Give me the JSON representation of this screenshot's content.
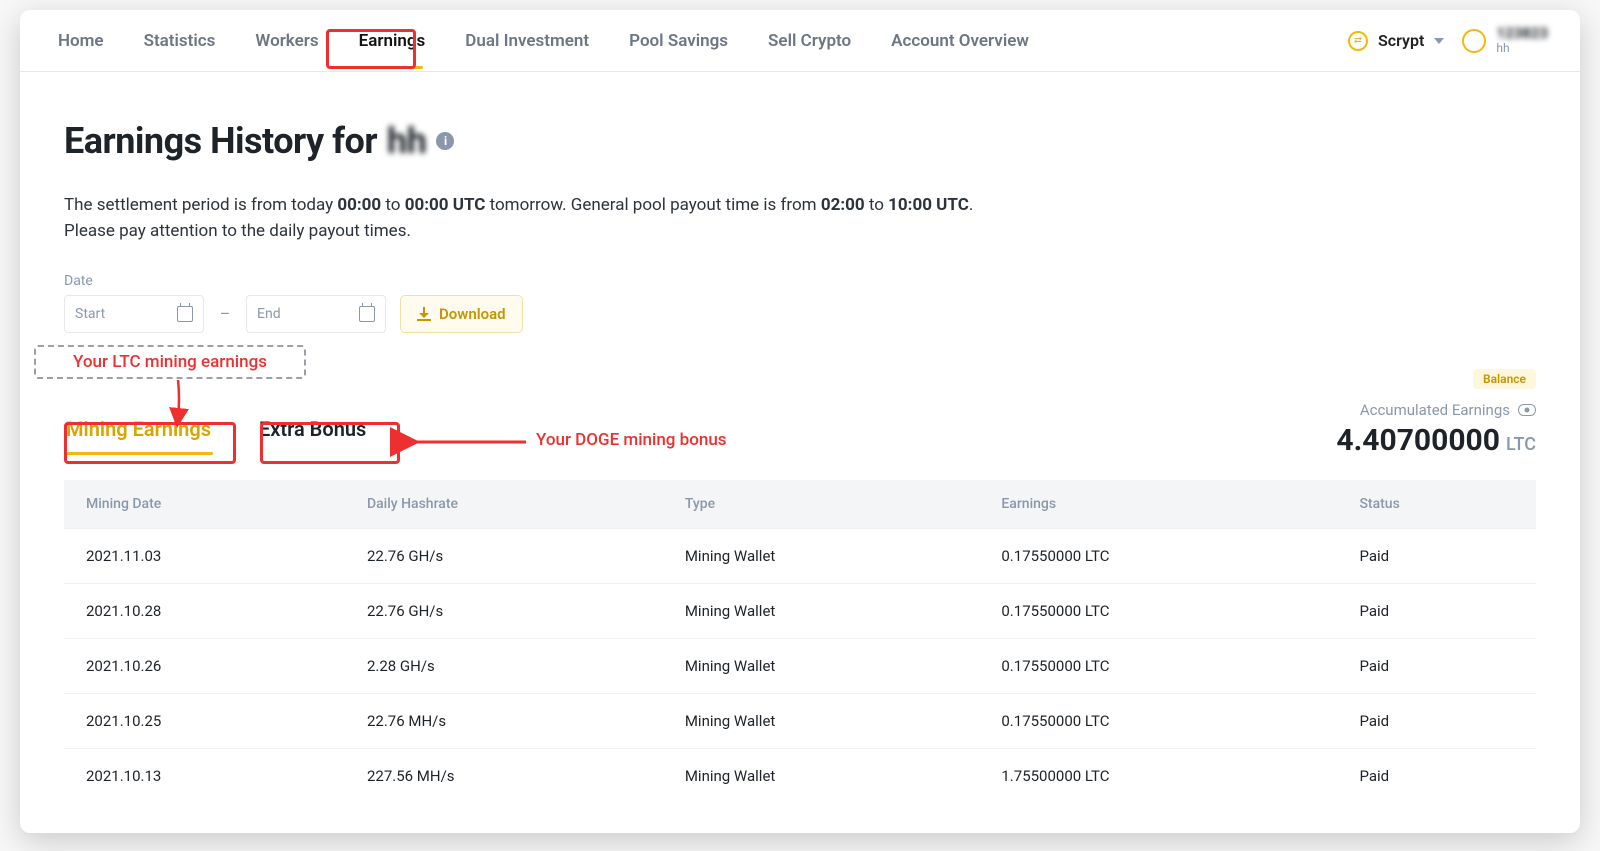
{
  "nav": {
    "items": [
      "Home",
      "Statistics",
      "Workers",
      "Earnings",
      "Dual Investment",
      "Pool Savings",
      "Sell Crypto",
      "Account Overview"
    ],
    "active_index": 3,
    "algo": "Scrypt",
    "user_id": "123823",
    "user_name": "hh"
  },
  "page": {
    "title_prefix": "Earnings History for ",
    "title_user": "hh",
    "note_html_parts": {
      "p1a": "The settlement period is from today ",
      "p1b": "00:00",
      "p1c": " to ",
      "p1d": "00:00 UTC",
      "p1e": " tomorrow. General pool payout time is from ",
      "p1f": "02:00",
      "p1g": " to ",
      "p1h": "10:00 UTC",
      "p1i": ".",
      "p2": "Please pay attention to the daily payout times."
    },
    "date_label": "Date",
    "start_placeholder": "Start",
    "end_placeholder": "End",
    "download_label": "Download",
    "balance_pill": "Balance"
  },
  "tabs": {
    "mining": "Mining Earnings",
    "bonus": "Extra Bonus"
  },
  "accumulated": {
    "label": "Accumulated Earnings",
    "value": "4.40700000",
    "unit": "LTC"
  },
  "table": {
    "headers": [
      "Mining Date",
      "Daily Hashrate",
      "Type",
      "Earnings",
      "Status"
    ],
    "rows": [
      {
        "date": "2021.11.03",
        "hash": "22.76 GH/s",
        "type": "Mining Wallet",
        "earn": "0.17550000 LTC",
        "status": "Paid"
      },
      {
        "date": "2021.10.28",
        "hash": "22.76 GH/s",
        "type": "Mining Wallet",
        "earn": "0.17550000 LTC",
        "status": "Paid"
      },
      {
        "date": "2021.10.26",
        "hash": "2.28 GH/s",
        "type": "Mining Wallet",
        "earn": "0.17550000 LTC",
        "status": "Paid"
      },
      {
        "date": "2021.10.25",
        "hash": "22.76 MH/s",
        "type": "Mining Wallet",
        "earn": "0.17550000 LTC",
        "status": "Paid"
      },
      {
        "date": "2021.10.13",
        "hash": "227.56 MH/s",
        "type": "Mining Wallet",
        "earn": "1.75500000 LTC",
        "status": "Paid"
      }
    ]
  },
  "annotations": {
    "ltc_label": "Your LTC mining earnings",
    "doge_label": "Your DOGE mining bonus"
  }
}
